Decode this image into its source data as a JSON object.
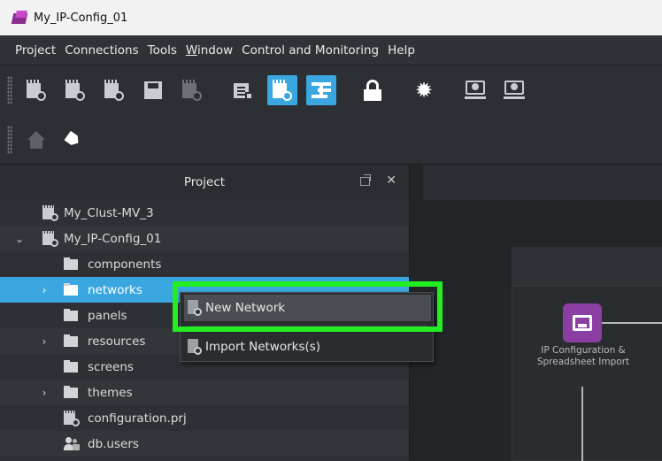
{
  "window": {
    "title": "My_IP-Config_01"
  },
  "menubar": {
    "items": [
      {
        "label": "Project"
      },
      {
        "label": "Connections"
      },
      {
        "label": "Tools"
      },
      {
        "label": "Window",
        "mnemonic": "W",
        "rest": "indow"
      },
      {
        "label": "Control and Monitoring"
      },
      {
        "label": "Help"
      }
    ]
  },
  "toolbar": {
    "active_accent": "#3aa7e0",
    "buttons": [
      "new-project-icon",
      "new-cluster-icon",
      "open-project-icon",
      "save-icon",
      "save-as-icon",
      "slides-icon",
      "project-active-icon",
      "hierarchy-icon",
      "lock-icon",
      "gear-icon",
      "upload-monitor-icon",
      "download-monitor-icon",
      "home-icon",
      "tag-icon"
    ]
  },
  "project_panel": {
    "title": "Project",
    "tree": [
      {
        "label": "My_Clust-MV_3",
        "icon": "project-icon"
      },
      {
        "label": "My_IP-Config_01",
        "icon": "project-icon",
        "expanded": true
      },
      {
        "label": "components",
        "icon": "folder-icon"
      },
      {
        "label": "networks",
        "icon": "folder-icon",
        "selected": true
      },
      {
        "label": "panels",
        "icon": "folder-icon"
      },
      {
        "label": "resources",
        "icon": "folder-icon"
      },
      {
        "label": "screens",
        "icon": "folder-icon"
      },
      {
        "label": "themes",
        "icon": "folder-icon"
      },
      {
        "label": "configuration.prj",
        "icon": "project-icon"
      },
      {
        "label": "db.users",
        "icon": "users-icon"
      }
    ]
  },
  "context_menu": {
    "items": [
      {
        "label": "New Network",
        "highlighted": true
      },
      {
        "label": "Import Networks(s)"
      }
    ],
    "highlight_color": "#22ee22"
  },
  "canvas": {
    "node": {
      "label": "IP Configuration & Spreadsheet Import",
      "color": "#8b3fa3"
    }
  }
}
